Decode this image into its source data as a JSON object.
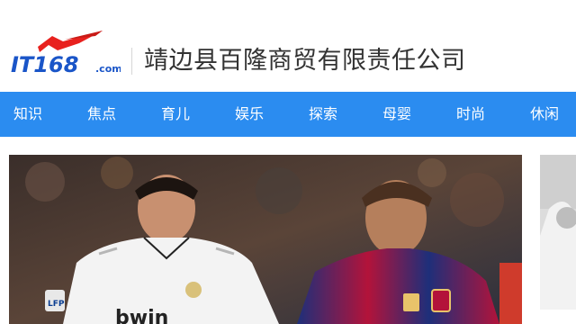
{
  "header": {
    "logo": {
      "text_main": "IT168",
      "text_suffix": ".com",
      "colors": {
        "blue": "#1a55c8",
        "red": "#e8211e"
      }
    },
    "company_name": "靖边县百隆商贸有限责任公司"
  },
  "nav": {
    "background": "#2b8cf0",
    "items": [
      {
        "label": "知识"
      },
      {
        "label": "焦点"
      },
      {
        "label": "育儿"
      },
      {
        "label": "娱乐"
      },
      {
        "label": "探索"
      },
      {
        "label": "母婴"
      },
      {
        "label": "时尚"
      },
      {
        "label": "休闲"
      }
    ]
  },
  "hero": {
    "jersey_text_left": "bwin",
    "badge_text_left": "LFP",
    "icon": "football-players-photo"
  },
  "side": {
    "icon": "partial-photo-thumbnail"
  }
}
